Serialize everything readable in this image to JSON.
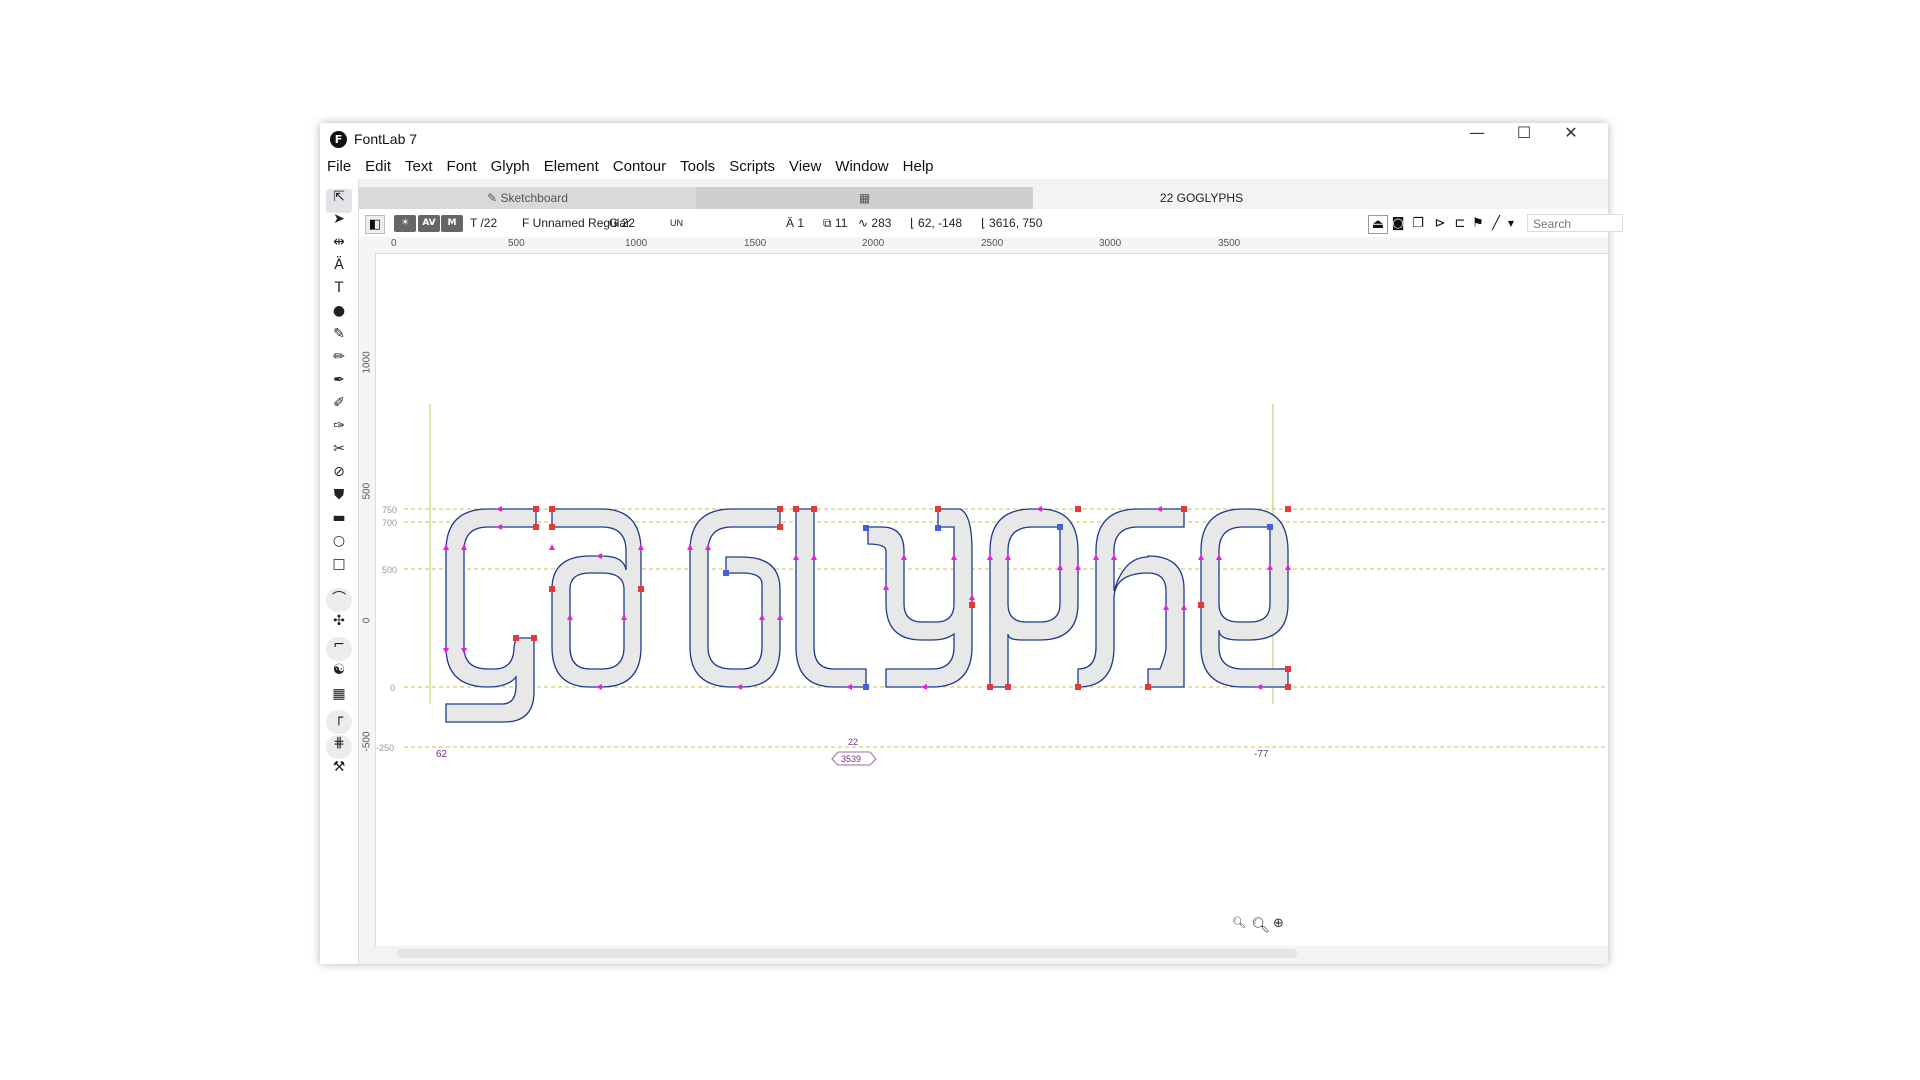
{
  "window": {
    "title": "FontLab 7",
    "logo": "F"
  },
  "window_controls": {
    "minimize": "—",
    "maximize": "☐",
    "close": "✕"
  },
  "menu": [
    "File",
    "Edit",
    "Text",
    "Font",
    "Glyph",
    "Element",
    "Contour",
    "Tools",
    "Scripts",
    "View",
    "Window",
    "Help"
  ],
  "tabs": {
    "sketchboard": "Sketchboard",
    "grid_icon": "grid-icon",
    "glyph_tab": "22 GOGLYPHS"
  },
  "props": {
    "btn1": "AV",
    "btn2": "M",
    "text_count": "T /22",
    "font_name": "F Unnamed Regular",
    "glyph_count": "G 22",
    "unicode": "UN",
    "a_count": "Ä 1",
    "contours": "11",
    "nodes": "283",
    "position": "62, -148",
    "size": "3616, 750",
    "search_placeholder": "Search"
  },
  "ruler": {
    "h_labels": [
      "0",
      "500",
      "1000",
      "1500",
      "2000",
      "2500",
      "3000",
      "3500"
    ],
    "v_labels": [
      "1000",
      "500",
      "0",
      "-500"
    ]
  },
  "metrics": {
    "m750": "750",
    "m700": "700",
    "m500": "500",
    "m0": "0",
    "m_250": "-250"
  },
  "bottom": {
    "lsb": "62",
    "rsb": "-77",
    "glyph_count": "22",
    "advance": "3539"
  },
  "colors": {
    "accent": "#e91ee0",
    "node": "#e53935",
    "guideline": "#c9c34a"
  }
}
